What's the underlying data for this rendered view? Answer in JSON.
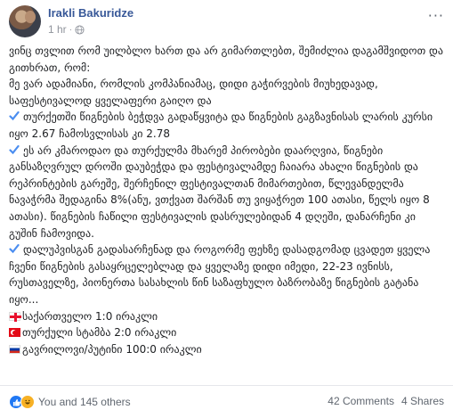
{
  "post": {
    "author": "Irakli Bakuridze",
    "time": "1 hr",
    "separator": "·",
    "more": "···",
    "paragraphs": [
      "ვინც თვლით რომ უილბლო ხართ და არ გიმართლებთ, შემიძლია დაგამშვიდოთ და გითხრათ, რომ:",
      "მე ვარ ადამიანი, რომლის კომპანიამაც, დიდი გაჭირვების მიუხედავად, საფესტივალოდ ყველაფერი გაიღო და"
    ],
    "checks": [
      "თურქეთში წიგნების ბეჭდვა გადაწყვიტა და წიგნების გაგზავნისას ლარის კურსი იყო 2.67 ჩამოსვლისას კი 2.78",
      "ეს არ კმაროდაო და თურქულმა მხარემ პირობები დაარღვია, წიგნები განსაზღვრულ დროში დაუბეჭდა და ფესტივალამდე ჩაიარა ახალი წიგნების და რეპრინტების გარეშე, შერჩენილ ფესტივალთან მიმართებით, წლევანდელმა ნავაჭრმა შედაგინა 8%(ანუ, ვთქვათ შარშან თუ ვიყაჭრეთ 100 ათასი, წელს იყო 8 ათასი). წიგნების ჩაწილი ფესტივალის დასრულებიდან 4 დღეში, დანარჩენი კი გუშინ ჩამოვიდა.",
      "დალუპვისგან გადასარჩენად და როგორმე ფეხზე დასადგომად ცვადეთ ყველა ჩვენი წიგნების გასაყრცელებლად და ყველაზე დიდი იმედი, 22-23 ივნისს, რუსთაველზე, პიონერთა სასახლის წინ საზაფხულო ბაზრობაზე წიგნების გატანა იყო..."
    ],
    "scores": [
      {
        "flag": "georgia-flag",
        "text": "საქართველო 1:0 ირაკლი"
      },
      {
        "flag": "turkey-flag",
        "text": "თურქული სტამბა 2:0 ირაკლი"
      },
      {
        "flag": "russia-flag",
        "text": "გავრილოვი/პუტინი 100:0 ირაკლი"
      }
    ]
  },
  "footer": {
    "reactions_text": "You and 145 others",
    "comments": "42 Comments",
    "shares": "4 Shares"
  },
  "colors": {
    "author": "#385898",
    "meta": "#90949c",
    "check": "#4a8df0",
    "like": "#2078f4",
    "haha": "#f7b125"
  }
}
